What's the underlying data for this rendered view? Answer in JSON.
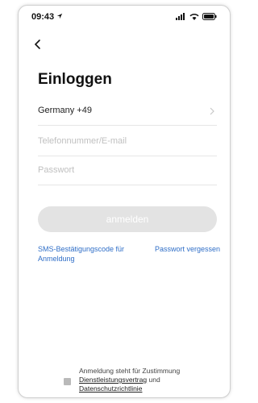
{
  "status_bar": {
    "time": "09:43",
    "icons": [
      "location-arrow-icon",
      "signal-icon",
      "wifi-icon",
      "battery-icon"
    ]
  },
  "header": {
    "back_icon": "chevron-left-icon",
    "title": "Einloggen"
  },
  "form": {
    "country": "Germany +49",
    "phone_placeholder": "Telefonnummer/E-mail",
    "password_placeholder": "Passwort",
    "login_label": "anmelden"
  },
  "links": {
    "sms_login": "SMS-Bestätigungscode für Anmeldung",
    "forgot_password": "Passwort vergessen"
  },
  "footer": {
    "agreement_text": "Anmeldung steht für Zustimmung",
    "service_agreement": "Dienstleistungsvertrag",
    "and": "und",
    "privacy_policy": "Datenschutzrichtlinie"
  },
  "colors": {
    "link": "#2f6ec7",
    "button_disabled": "#e3e3e3",
    "placeholder": "#c0c0c0"
  }
}
